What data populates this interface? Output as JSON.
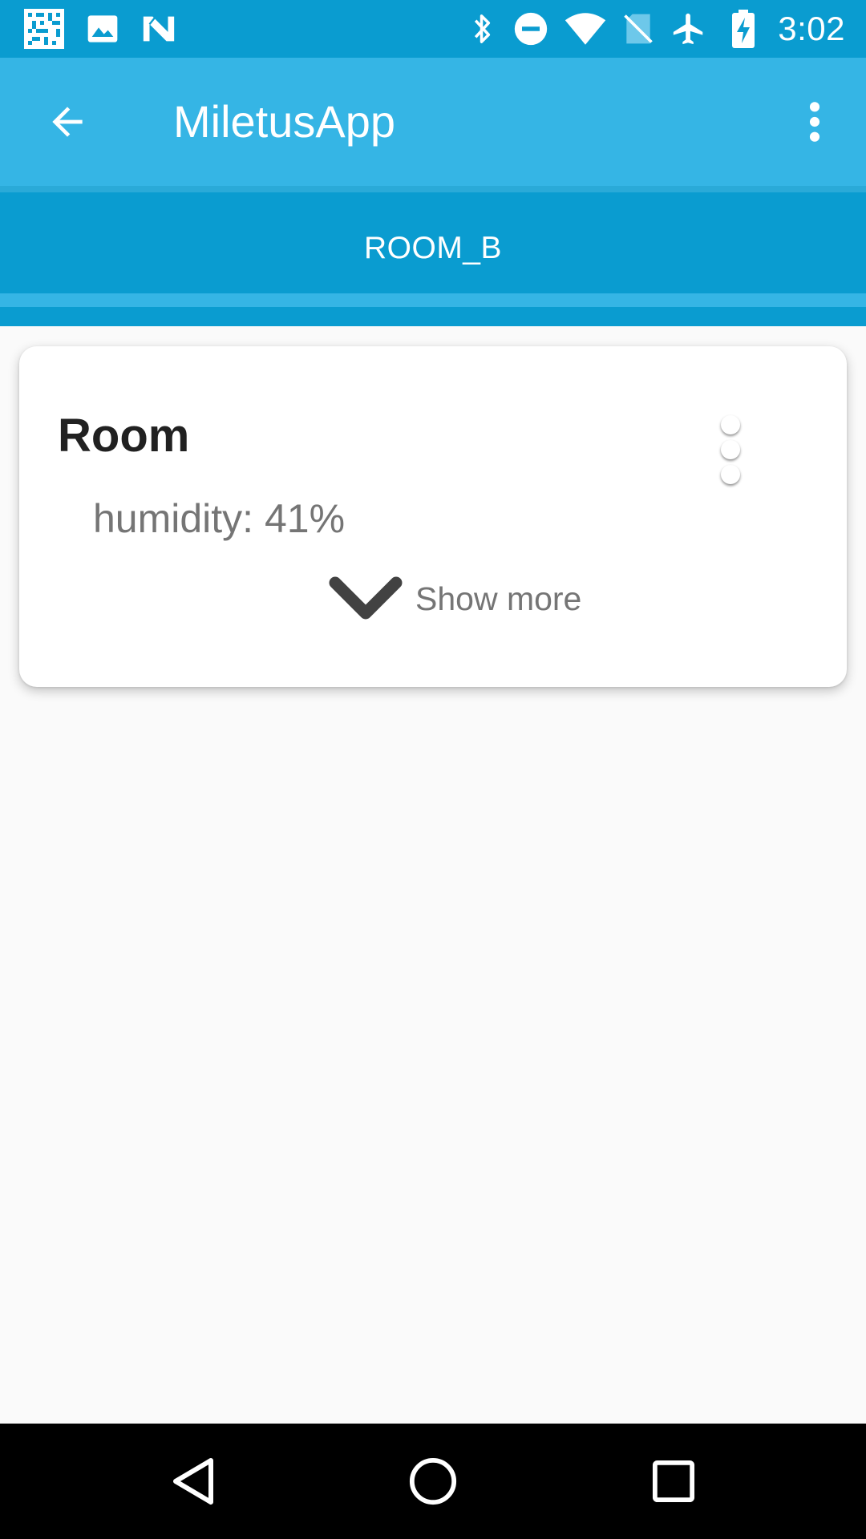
{
  "status_bar": {
    "time": "3:02",
    "icons": [
      "qr-code-icon",
      "image-icon",
      "n-logo-icon",
      "bluetooth-icon",
      "do-not-disturb-icon",
      "wifi-icon",
      "no-sim-icon",
      "airplane-icon",
      "battery-charging-icon"
    ]
  },
  "app_bar": {
    "title": "MiletusApp",
    "back_icon": "arrow-back-icon",
    "overflow_icon": "more-vert-icon"
  },
  "tabs": [
    {
      "label": "ROOM_B",
      "selected": true
    }
  ],
  "card": {
    "title": "Room",
    "detail": "humidity: 41%",
    "show_more_label": "Show more",
    "menu_icon": "more-vert-icon",
    "expand_icon": "chevron-down-icon"
  },
  "nav_bar": {
    "items": [
      "back-triangle-icon",
      "home-circle-icon",
      "recents-square-icon"
    ]
  },
  "colors": {
    "status_bar": "#0a9cd0",
    "app_bar": "#35b5e5",
    "tab_bar": "#0a9cd0",
    "background": "#fafafa",
    "card": "#ffffff",
    "title_text": "#212121",
    "secondary_text": "#757575"
  }
}
